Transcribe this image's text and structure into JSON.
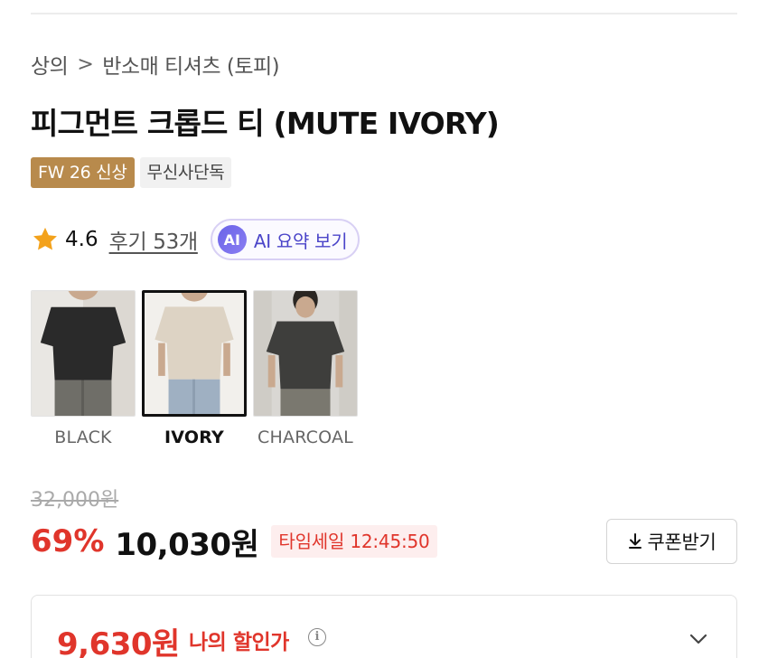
{
  "breadcrumb": {
    "category": "상의",
    "separator": ">",
    "subcategory": "반소매 티셔츠 (토피)"
  },
  "product": {
    "title": "피그먼트 크롭드 티 (MUTE IVORY)",
    "badges": [
      "FW 26 신상",
      "무신사단독"
    ]
  },
  "rating": {
    "value": "4.6",
    "reviews": "후기 53개",
    "ai_badge": "AI",
    "ai_summary": "AI 요약 보기"
  },
  "colors": [
    {
      "label": "BLACK",
      "selected": false
    },
    {
      "label": "IVORY",
      "selected": true
    },
    {
      "label": "CHARCOAL",
      "selected": false
    }
  ],
  "pricing": {
    "original": "32,000원",
    "discount": "69%",
    "sale": "10,030원",
    "timesale": "타임세일 12:45:50",
    "coupon_button": "쿠폰받기",
    "my_price": "9,630원",
    "my_price_label": "나의 할인가",
    "info_glyph": "i"
  },
  "colors_theme": {
    "accent_red": "#e0352b",
    "badge_gold": "#b88a4c",
    "ai_purple": "#4b45c9"
  },
  "icons": [
    "star-icon",
    "download-icon",
    "info-icon",
    "chevron-down-icon"
  ]
}
